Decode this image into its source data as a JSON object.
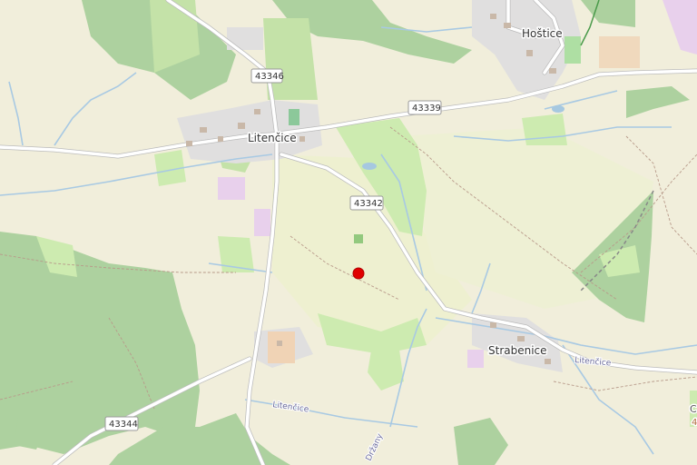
{
  "map": {
    "places": [
      {
        "id": "litencice",
        "label": "Litenčice"
      },
      {
        "id": "hostice",
        "label": "Hoštice"
      },
      {
        "id": "strabenice",
        "label": "Strabenice"
      }
    ],
    "road_refs": [
      {
        "id": "r43346",
        "label": "43346"
      },
      {
        "id": "r43339",
        "label": "43339"
      },
      {
        "id": "r43342",
        "label": "43342"
      },
      {
        "id": "r43344",
        "label": "43344"
      }
    ],
    "stream_labels": [
      {
        "id": "litencice-stream-1",
        "label": "Litenčice"
      },
      {
        "id": "litencice-stream-2",
        "label": "Litenčice"
      },
      {
        "id": "drzany-stream",
        "label": "Držany"
      }
    ],
    "edge_label": "C",
    "edge_label_2": "4",
    "marker": {
      "color": "#e00000"
    },
    "colors": {
      "background": "#f2efe0",
      "forest": "#aed1a0",
      "road": "#ffffff",
      "residential": "#e0dfdf",
      "water": "#a6c8e0",
      "marker": "#e00000"
    }
  }
}
